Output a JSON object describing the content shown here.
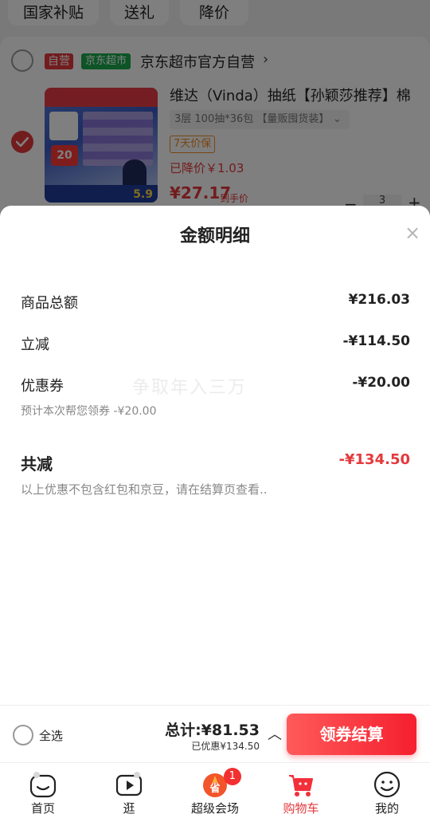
{
  "background": {
    "chips": [
      "国家补贴",
      "送礼",
      "降价"
    ],
    "shop": {
      "self_tag": "自营",
      "super_tag": "京东超市",
      "name": "京东超市官方自营",
      "arrow": "›"
    },
    "product": {
      "title": "维达（Vinda）抽纸【孙颖莎推荐】棉",
      "spec": "3层 100抽*36包 【量贩囤货装】",
      "spec_arrow": "⌄",
      "guarantee": "7天价保",
      "price_drop": "已降价￥1.03",
      "price": "¥27.17",
      "price_tag": "到手价",
      "image_price": "5.9",
      "image_num": "20",
      "qty_minus": "−",
      "qty": "3",
      "qty_plus": "+"
    }
  },
  "sheet": {
    "title": "金额明细",
    "close": "×",
    "rows": [
      {
        "label": "商品总额",
        "value": "¥216.03"
      },
      {
        "label": "立减",
        "value": "-¥114.50"
      },
      {
        "label": "优惠券",
        "value": "-¥20.00"
      }
    ],
    "coupon_note": "预计本次帮您领券 -¥20.00",
    "total_label": "共减",
    "total_value": "-¥134.50",
    "disclaimer": "以上优惠不包含红包和京豆，请在结算页查看..",
    "watermark": "争取年入三万"
  },
  "checkout": {
    "select_all": "全选",
    "sum": "总计:¥81.53",
    "saved": "已优惠¥134.50",
    "chevron": "︿",
    "pay_button": "领券结算"
  },
  "tabs": [
    {
      "label": "首页",
      "icon": "home-icon"
    },
    {
      "label": "逛",
      "icon": "video-icon"
    },
    {
      "label": "超级会场",
      "icon": "venue-icon",
      "badge": "1"
    },
    {
      "label": "购物车",
      "icon": "cart-icon",
      "active": true
    },
    {
      "label": "我的",
      "icon": "profile-icon"
    }
  ],
  "colors": {
    "accent": "#e4393c",
    "pay_gradient_start": "#ff5a5a",
    "pay_gradient_end": "#f51f2f",
    "super_tag": "#1aa94c"
  }
}
